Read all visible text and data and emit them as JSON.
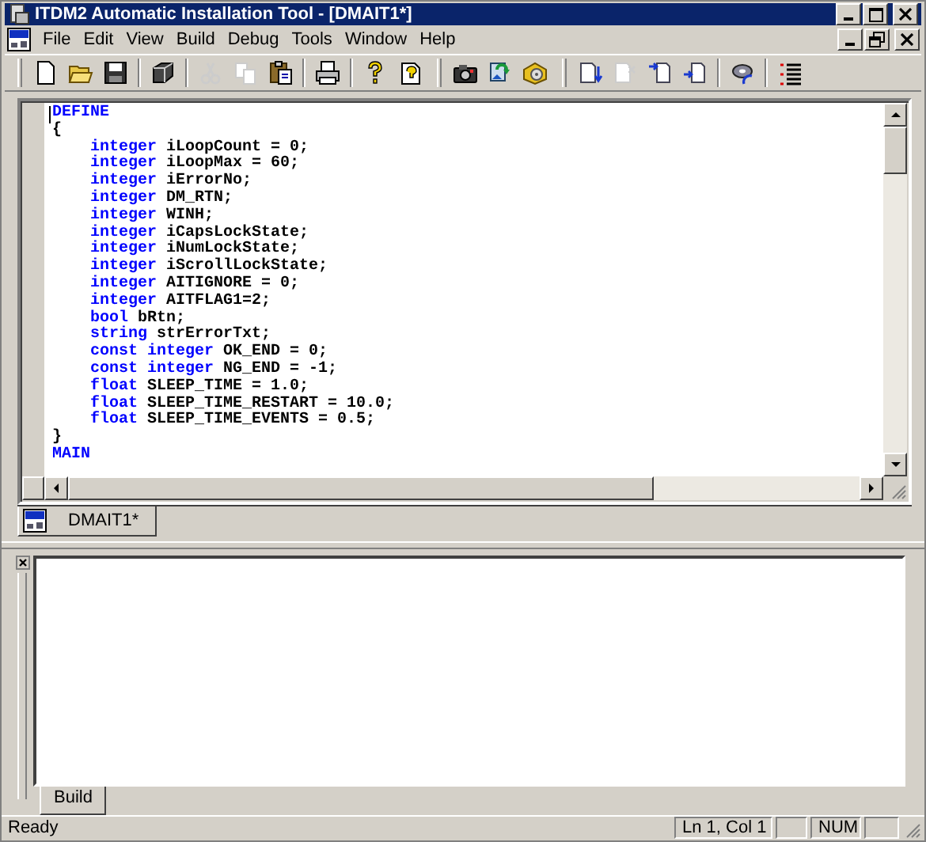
{
  "window": {
    "title": "ITDM2 Automatic Installation Tool - [DMAIT1*]"
  },
  "menu": [
    "File",
    "Edit",
    "View",
    "Build",
    "Debug",
    "Tools",
    "Window",
    "Help"
  ],
  "toolbar": [
    [
      {
        "kind": "new",
        "disabled": false
      },
      {
        "kind": "open",
        "disabled": false
      },
      {
        "kind": "save",
        "disabled": false
      }
    ],
    [
      {
        "kind": "cube",
        "disabled": false
      }
    ],
    [
      {
        "kind": "cut",
        "disabled": true
      },
      {
        "kind": "copy",
        "disabled": true
      },
      {
        "kind": "paste",
        "disabled": false
      }
    ],
    [
      {
        "kind": "print",
        "disabled": false
      }
    ],
    [
      {
        "kind": "help",
        "disabled": false
      },
      {
        "kind": "pagehelp",
        "disabled": false
      }
    ],
    [
      {
        "kind": "camera",
        "disabled": false
      },
      {
        "kind": "arrows",
        "disabled": false
      },
      {
        "kind": "package",
        "disabled": false
      }
    ],
    [
      {
        "kind": "pagedown",
        "disabled": false
      },
      {
        "kind": "pagex",
        "disabled": true
      },
      {
        "kind": "pagein",
        "disabled": false
      },
      {
        "kind": "pageright",
        "disabled": false
      }
    ],
    [
      {
        "kind": "disc",
        "disabled": false
      }
    ],
    [
      {
        "kind": "list",
        "disabled": false
      }
    ]
  ],
  "editor": {
    "lines": [
      [
        {
          "kind": "keyword",
          "text": "DEFINE"
        }
      ],
      [
        {
          "kind": "plain",
          "text": "{"
        }
      ],
      [
        {
          "kind": "keyword",
          "text": "    integer"
        },
        {
          "kind": "plain",
          "text": " iLoopCount = 0;"
        }
      ],
      [
        {
          "kind": "keyword",
          "text": "    integer"
        },
        {
          "kind": "plain",
          "text": " iLoopMax = 60;"
        }
      ],
      [
        {
          "kind": "keyword",
          "text": "    integer"
        },
        {
          "kind": "plain",
          "text": " iErrorNo;"
        }
      ],
      [
        {
          "kind": "keyword",
          "text": "    integer"
        },
        {
          "kind": "plain",
          "text": " DM_RTN;"
        }
      ],
      [
        {
          "kind": "keyword",
          "text": "    integer"
        },
        {
          "kind": "plain",
          "text": " WINH;"
        }
      ],
      [
        {
          "kind": "keyword",
          "text": "    integer"
        },
        {
          "kind": "plain",
          "text": " iCapsLockState;"
        }
      ],
      [
        {
          "kind": "keyword",
          "text": "    integer"
        },
        {
          "kind": "plain",
          "text": " iNumLockState;"
        }
      ],
      [
        {
          "kind": "keyword",
          "text": "    integer"
        },
        {
          "kind": "plain",
          "text": " iScrollLockState;"
        }
      ],
      [
        {
          "kind": "keyword",
          "text": "    integer"
        },
        {
          "kind": "plain",
          "text": " AITIGNORE = 0;"
        }
      ],
      [
        {
          "kind": "keyword",
          "text": "    integer"
        },
        {
          "kind": "plain",
          "text": " AITFLAG1=2;"
        }
      ],
      [
        {
          "kind": "keyword",
          "text": "    bool"
        },
        {
          "kind": "plain",
          "text": " bRtn;"
        }
      ],
      [
        {
          "kind": "keyword",
          "text": "    string"
        },
        {
          "kind": "plain",
          "text": " strErrorTxt;"
        }
      ],
      [
        {
          "kind": "keyword",
          "text": "    const integer"
        },
        {
          "kind": "plain",
          "text": " OK_END = 0;"
        }
      ],
      [
        {
          "kind": "keyword",
          "text": "    const integer"
        },
        {
          "kind": "plain",
          "text": " NG_END = -1;"
        }
      ],
      [
        {
          "kind": "keyword",
          "text": "    float"
        },
        {
          "kind": "plain",
          "text": " SLEEP_TIME = 1.0;"
        }
      ],
      [
        {
          "kind": "keyword",
          "text": "    float"
        },
        {
          "kind": "plain",
          "text": " SLEEP_TIME_RESTART = 10.0;"
        }
      ],
      [
        {
          "kind": "keyword",
          "text": "    float"
        },
        {
          "kind": "plain",
          "text": " SLEEP_TIME_EVENTS = 0.5;"
        }
      ],
      [
        {
          "kind": "plain",
          "text": "}"
        }
      ],
      [
        {
          "kind": "keyword",
          "text": "MAIN"
        }
      ]
    ]
  },
  "document_tabs": [
    {
      "label": "DMAIT1*",
      "selected": true
    }
  ],
  "output_tabs": [
    {
      "label": "Build",
      "selected": true
    }
  ],
  "status_bar": {
    "message": "Ready",
    "position": "Ln 1, Col 1",
    "indicator": "NUM"
  }
}
